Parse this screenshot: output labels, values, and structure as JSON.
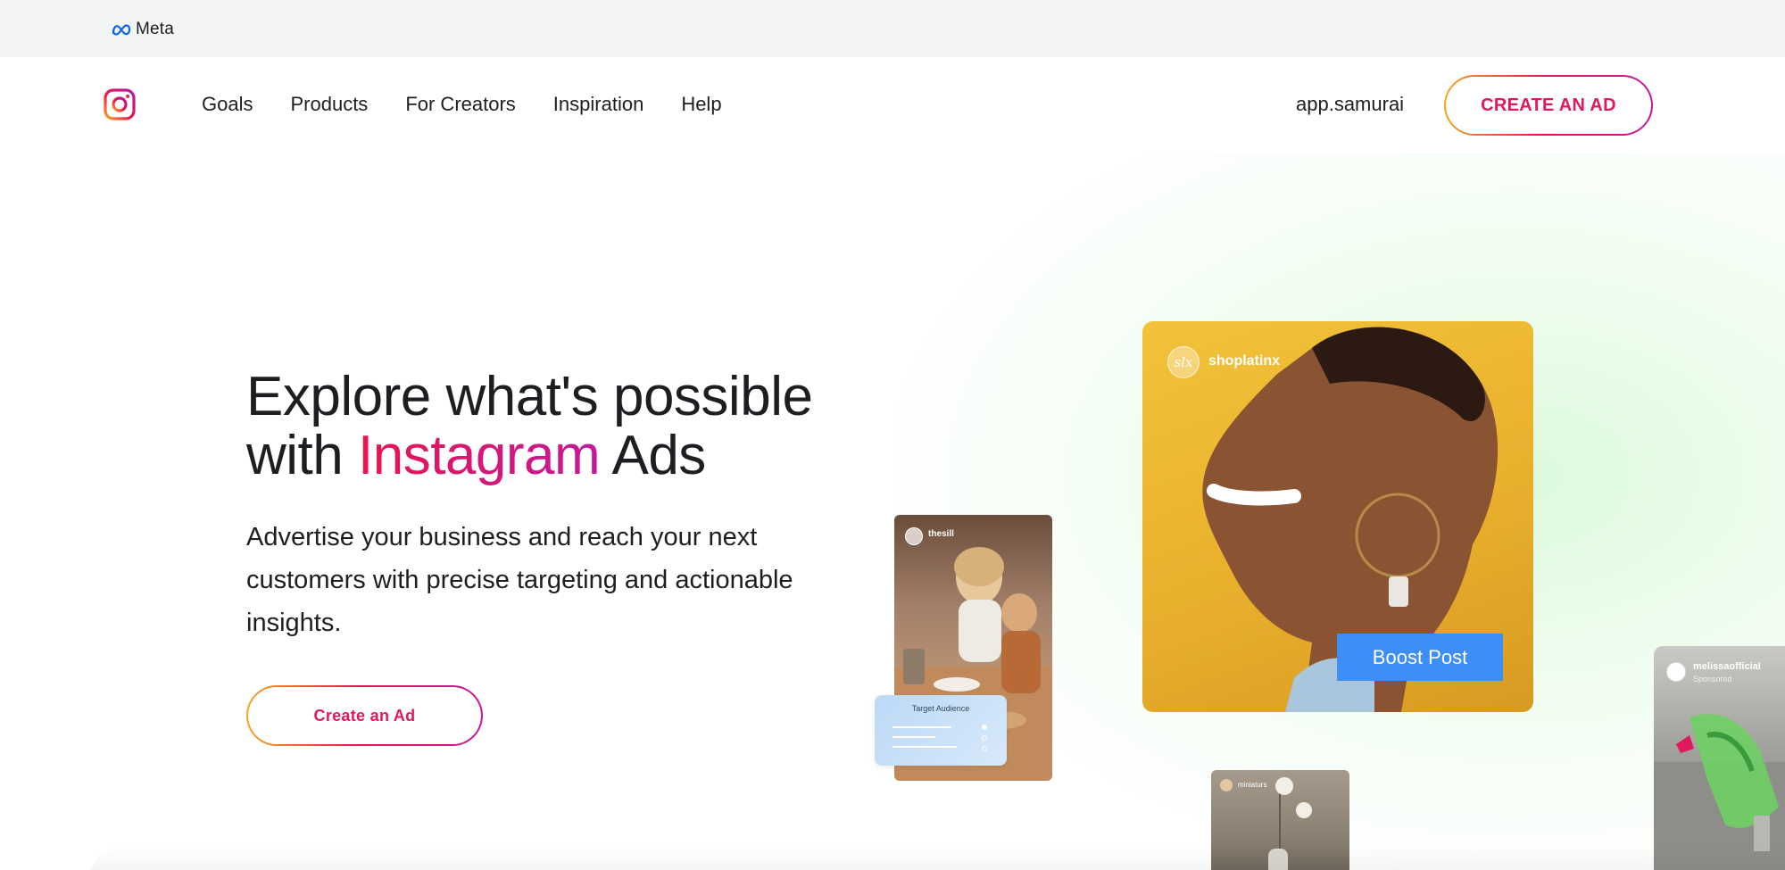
{
  "meta_bar": {
    "brand": "Meta"
  },
  "nav": {
    "links": [
      "Goals",
      "Products",
      "For Creators",
      "Inspiration",
      "Help"
    ],
    "user": "app.samurai",
    "cta_label": "CREATE AN AD"
  },
  "hero": {
    "title_line1": "Explore what's possible",
    "title_line2_prefix": "with ",
    "title_accent": "Instagram",
    "title_line2_suffix": " Ads",
    "subtitle": "Advertise your business and reach your next customers with precise targeting and actionable insights.",
    "cta_label": "Create an Ad"
  },
  "ads": {
    "main": {
      "handle": "shoplatinx",
      "avatar_text": "slx",
      "button_label": "Boost Post"
    },
    "story": {
      "handle": "thesill"
    },
    "target_card": {
      "title": "Target Audience"
    },
    "small": {
      "handle": "miniaturs"
    },
    "edge": {
      "handle": "melissaofficial",
      "sub": "Sponsored"
    }
  },
  "colors": {
    "accent_pink": "#e0185c",
    "accent_orange": "#f5a623",
    "boost_blue": "#3d8ff5",
    "meta_bar_bg": "#f3f5f4"
  },
  "icons": [
    "meta-logo-icon",
    "instagram-logo-icon"
  ]
}
